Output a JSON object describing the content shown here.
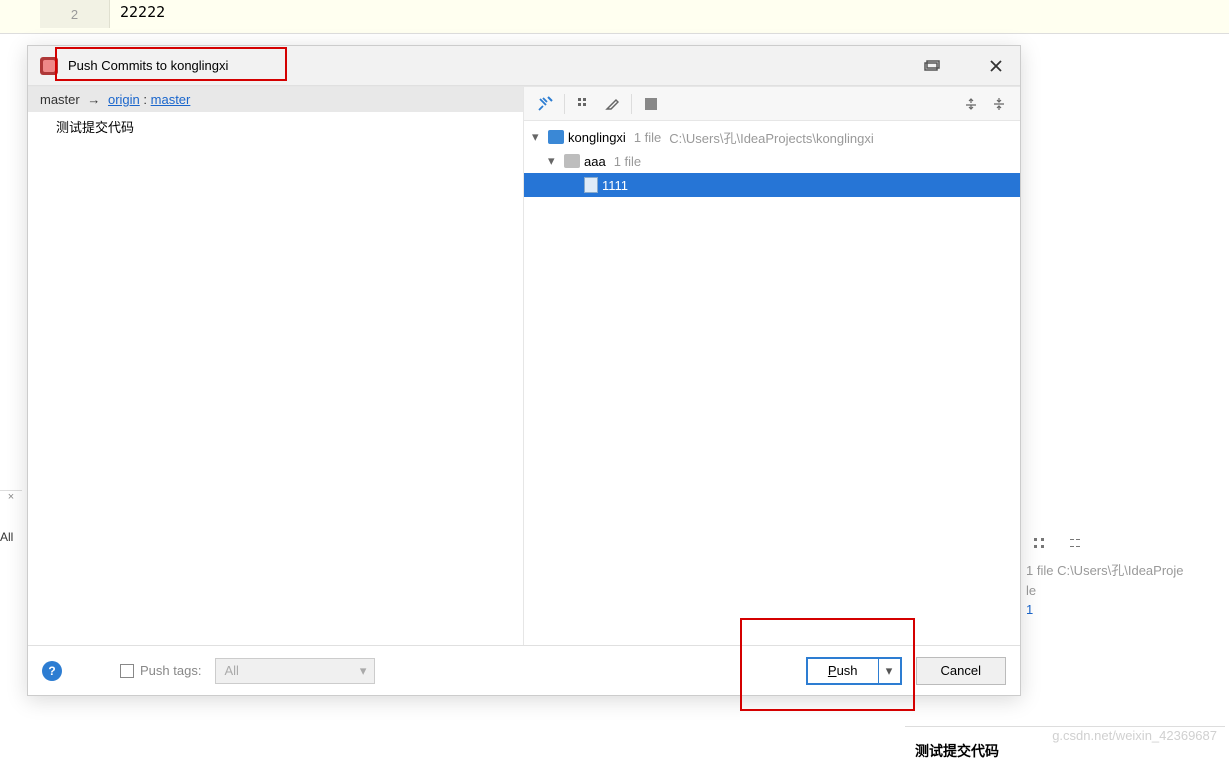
{
  "editor": {
    "line_number": "2",
    "code": "22222"
  },
  "dialog": {
    "title": "Push Commits to konglingxi",
    "branch_local": "master",
    "branch_remote_name": "origin",
    "branch_remote_branch": "master",
    "commit_message": "测试提交代码"
  },
  "tree": {
    "root_name": "konglingxi",
    "root_meta_files": "1 file",
    "root_path": "C:\\Users\\孔\\IdeaProjects\\konglingxi",
    "folder_name": "aaa",
    "folder_meta": "1 file",
    "file_name": "1111"
  },
  "footer": {
    "push_tags_label": "Push tags:",
    "tags_select_value": "All",
    "push_button": "Push",
    "cancel_button": "Cancel"
  },
  "bg_right": {
    "line1": "1 file  C:\\Users\\孔\\IdeaProje",
    "line2": "le",
    "line3": "1"
  },
  "bg_left": {
    "all_label": "All"
  },
  "bg_bottom": {
    "commit_label": "测试提交代码"
  },
  "watermark": "g.csdn.net/weixin_42369687"
}
